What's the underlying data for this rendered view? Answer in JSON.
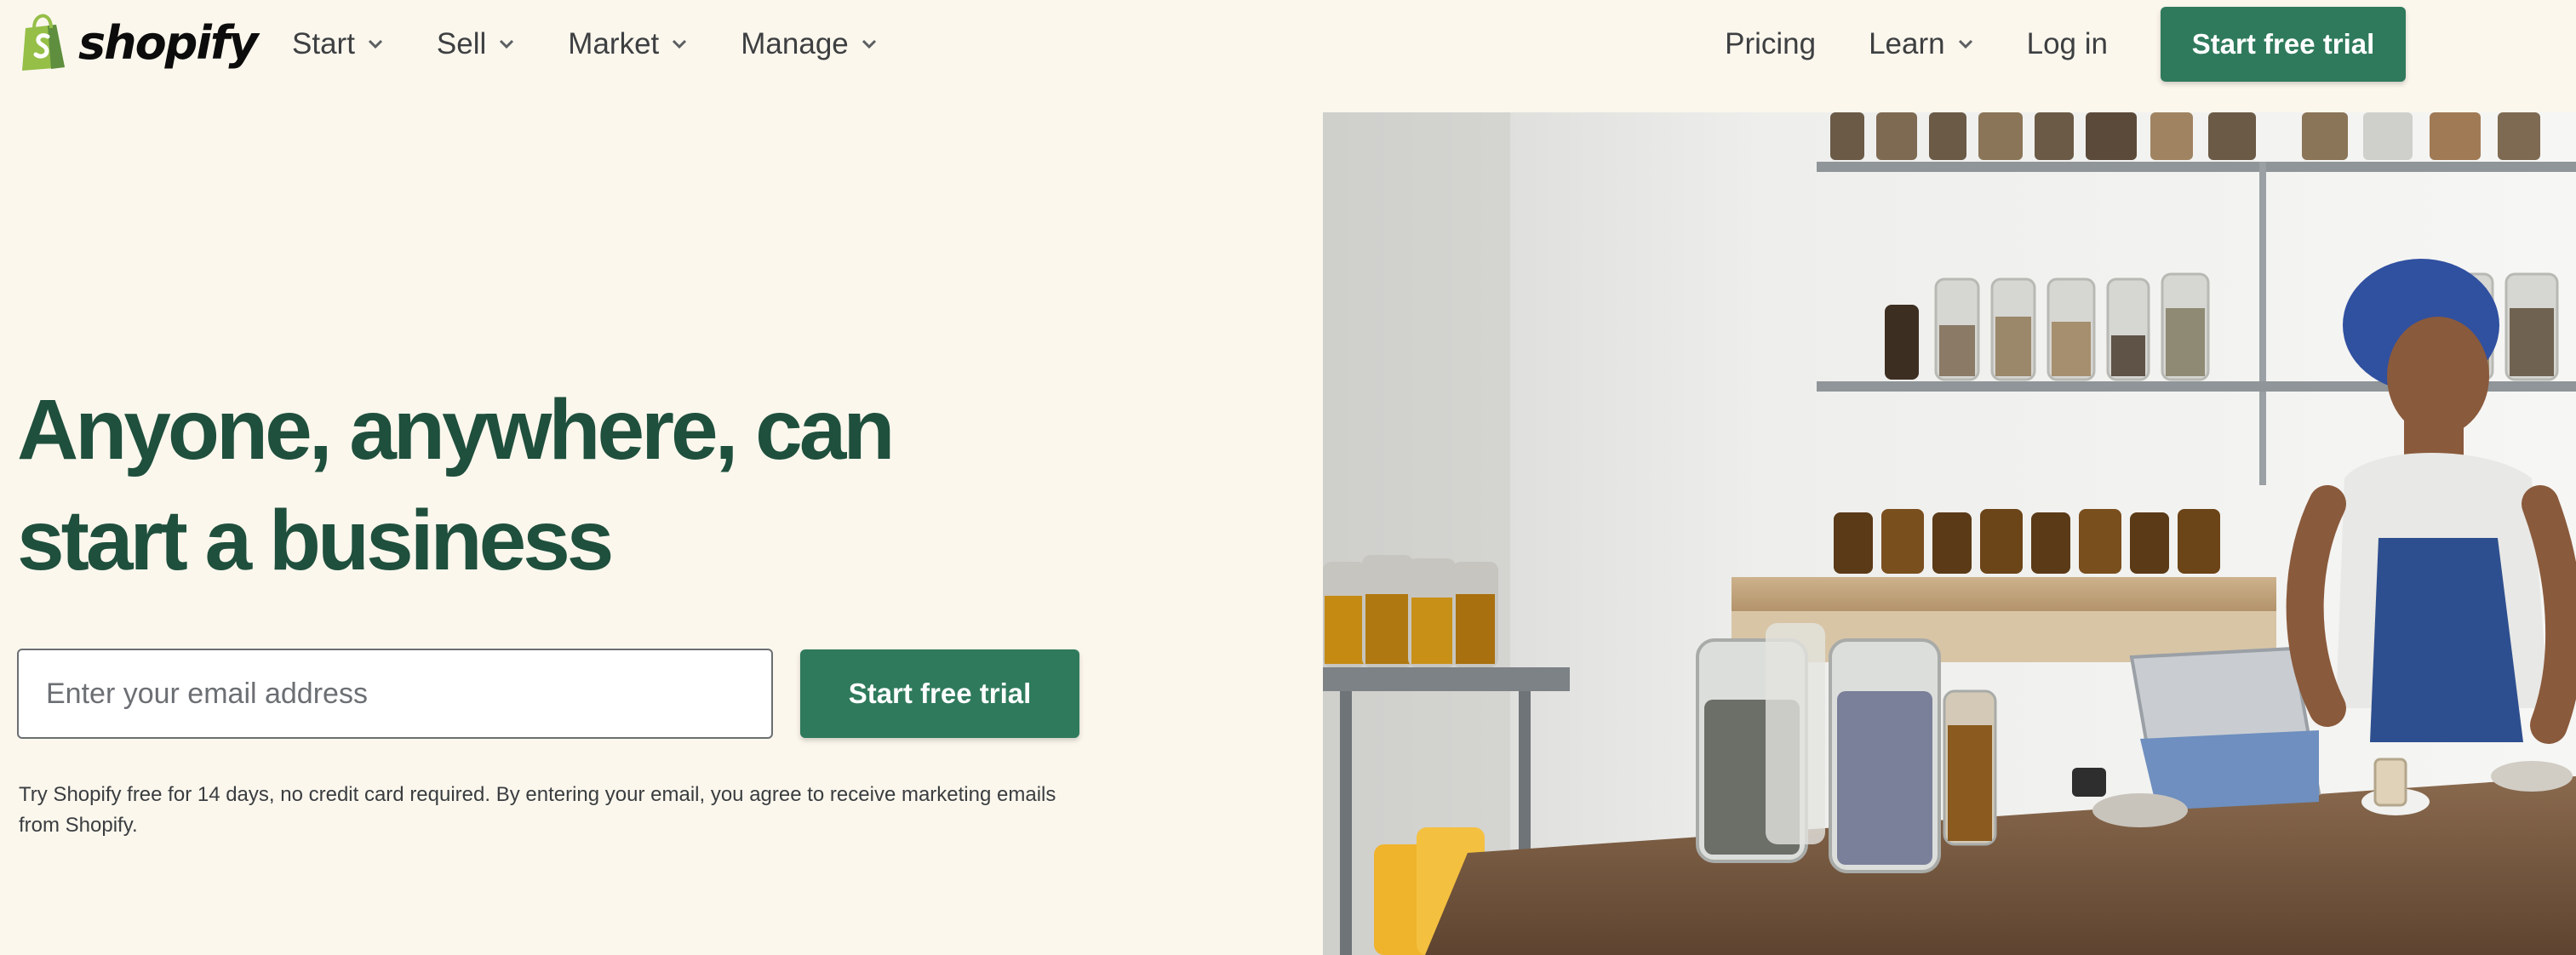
{
  "brand": {
    "name": "shopify",
    "logo_icon": "shopping-bag-logo-icon",
    "color": "#95bf47"
  },
  "nav": {
    "left": [
      {
        "label": "Start",
        "has_dropdown": true
      },
      {
        "label": "Sell",
        "has_dropdown": true
      },
      {
        "label": "Market",
        "has_dropdown": true
      },
      {
        "label": "Manage",
        "has_dropdown": true
      }
    ],
    "right": [
      {
        "label": "Pricing",
        "has_dropdown": false
      },
      {
        "label": "Learn",
        "has_dropdown": true
      },
      {
        "label": "Log in",
        "has_dropdown": false
      }
    ],
    "cta_label": "Start free trial"
  },
  "hero": {
    "headline_line1": "Anyone, anywhere, can",
    "headline_line2": "start a business",
    "email_placeholder": "Enter your email address",
    "cta_label": "Start free trial",
    "disclaimer": "Try Shopify free for 14 days, no credit card required. By entering your email, you agree to receive marketing emails from Shopify."
  },
  "colors": {
    "background": "#fbf7ed",
    "accent_green": "#2f7a5c",
    "headline_green": "#1f4f3d"
  }
}
